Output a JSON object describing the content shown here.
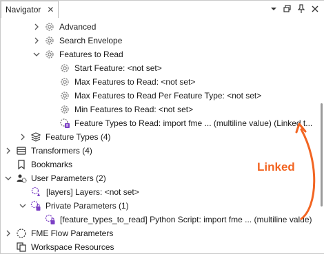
{
  "window": {
    "tab_title": "Navigator",
    "tab_close": "✕"
  },
  "title_icons": {
    "dropdown": "▾",
    "float": "⧉",
    "pin": "📌",
    "close": "✕"
  },
  "tree": [
    {
      "label": "Advanced",
      "icon": "gear-icon"
    },
    {
      "label": "Search Envelope",
      "icon": "gear-icon"
    },
    {
      "label": "Features to Read",
      "icon": "gear-icon"
    },
    {
      "label": "Start Feature: <not set>",
      "icon": "gear-icon"
    },
    {
      "label": "Max Features to Read: <not set>",
      "icon": "gear-icon"
    },
    {
      "label": "Max Features to Read Per Feature Type: <not set>",
      "icon": "gear-icon"
    },
    {
      "label": "Min Features to Read: <not set>",
      "icon": "gear-icon"
    },
    {
      "label": "Feature Types to Read: import fme ... (multiline value) (Linked t...",
      "icon": "linked-parameter-icon"
    },
    {
      "label": "Feature Types (4)",
      "icon": "layers-icon"
    },
    {
      "label": "Transformers (4)",
      "icon": "transformers-icon"
    },
    {
      "label": "Bookmarks",
      "icon": "bookmark-icon"
    },
    {
      "label": "User Parameters (2)",
      "icon": "user-parameters-icon"
    },
    {
      "label": "[layers] Layers: <not set>",
      "icon": "user-parameter-icon"
    },
    {
      "label": "Private Parameters (1)",
      "icon": "private-parameter-icon"
    },
    {
      "label": "[feature_types_to_read] Python Script: import fme ... (multiline value)",
      "icon": "private-parameter-icon"
    },
    {
      "label": "FME Flow Parameters",
      "icon": "flow-parameters-icon"
    },
    {
      "label": "Workspace Resources",
      "icon": "workspace-resources-icon"
    }
  ],
  "annotation": {
    "text": "Linked",
    "color": "#f26522"
  },
  "colors": {
    "gear": "#7a7a7a",
    "purple": "#7b3fc4",
    "border": "#c9c9c9"
  }
}
